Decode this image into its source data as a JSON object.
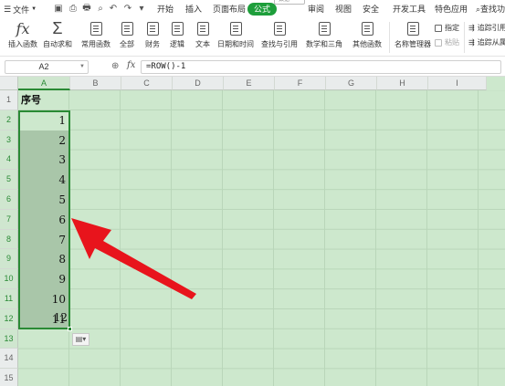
{
  "menubar": {
    "file_label": "文件",
    "tabs": [
      {
        "label": "开始",
        "active": false
      },
      {
        "label": "插入",
        "active": false
      },
      {
        "label": "页面布局",
        "active": false
      },
      {
        "label": "公式",
        "active": true
      },
      {
        "label": "审阅",
        "active": false
      },
      {
        "label": "视图",
        "active": false
      },
      {
        "label": "安全",
        "active": false
      },
      {
        "label": "开发工具",
        "active": false
      },
      {
        "label": "特色应用",
        "active": false
      }
    ],
    "tab_hint": "数据",
    "search_label": "查找功"
  },
  "ribbon": {
    "insert_function": "插入函数",
    "autosum": "自动求和",
    "common_functions": "常用函数",
    "all": "全部",
    "finance": "财务",
    "logic": "逻辑",
    "text": "文本",
    "datetime": "日期和时间",
    "lookup": "查找与引用",
    "math": "数学和三角",
    "other": "其他函数",
    "name_manager": "名称管理器",
    "specify": "指定",
    "paste": "粘贴",
    "trace_precedents": "追踪引用",
    "trace_dependents": "追踪从属"
  },
  "formula_bar": {
    "name_box": "A2",
    "fx": "fx",
    "formula": "=ROW()-1"
  },
  "sheet": {
    "columns": [
      "A",
      "B",
      "C",
      "D",
      "E",
      "F",
      "G",
      "H",
      "I"
    ],
    "rows": [
      "1",
      "2",
      "3",
      "4",
      "5",
      "6",
      "7",
      "8",
      "9",
      "10",
      "11",
      "12",
      "13",
      "14",
      "15"
    ],
    "header_cell": "序号",
    "values": [
      "1",
      "2",
      "3",
      "4",
      "5",
      "6",
      "7",
      "8",
      "9",
      "10",
      "11",
      "12"
    ],
    "autofill_icon": "auto-fill-options-icon"
  },
  "colors": {
    "accent": "#1e9e3b",
    "sheet_background": "#cde8cd",
    "selection_border": "#2a8a35",
    "annotation_arrow": "#e8141c"
  }
}
